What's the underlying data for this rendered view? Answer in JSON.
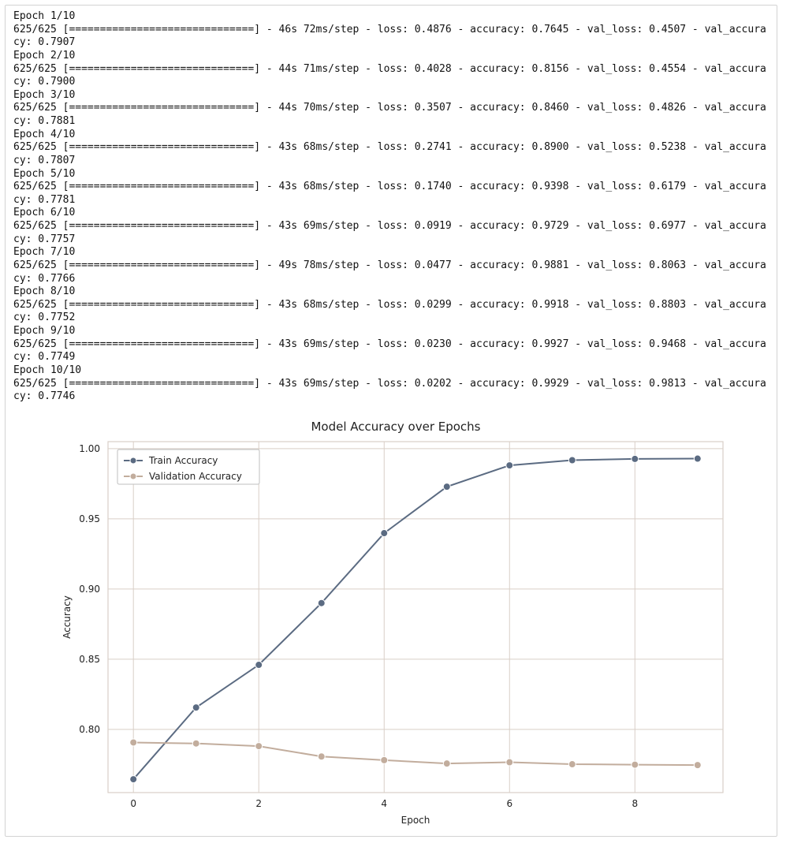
{
  "log": {
    "epochs": [
      {
        "header": "Epoch 1/10",
        "progress": "625/625 [==============================] - 46s 72ms/step - loss: 0.4876 - accuracy: 0.7645 - val_loss: 0.4507 - val_accuracy: 0.7907"
      },
      {
        "header": "Epoch 2/10",
        "progress": "625/625 [==============================] - 44s 71ms/step - loss: 0.4028 - accuracy: 0.8156 - val_loss: 0.4554 - val_accuracy: 0.7900"
      },
      {
        "header": "Epoch 3/10",
        "progress": "625/625 [==============================] - 44s 70ms/step - loss: 0.3507 - accuracy: 0.8460 - val_loss: 0.4826 - val_accuracy: 0.7881"
      },
      {
        "header": "Epoch 4/10",
        "progress": "625/625 [==============================] - 43s 68ms/step - loss: 0.2741 - accuracy: 0.8900 - val_loss: 0.5238 - val_accuracy: 0.7807"
      },
      {
        "header": "Epoch 5/10",
        "progress": "625/625 [==============================] - 43s 68ms/step - loss: 0.1740 - accuracy: 0.9398 - val_loss: 0.6179 - val_accuracy: 0.7781"
      },
      {
        "header": "Epoch 6/10",
        "progress": "625/625 [==============================] - 43s 69ms/step - loss: 0.0919 - accuracy: 0.9729 - val_loss: 0.6977 - val_accuracy: 0.7757"
      },
      {
        "header": "Epoch 7/10",
        "progress": "625/625 [==============================] - 49s 78ms/step - loss: 0.0477 - accuracy: 0.9881 - val_loss: 0.8063 - val_accuracy: 0.7766"
      },
      {
        "header": "Epoch 8/10",
        "progress": "625/625 [==============================] - 43s 68ms/step - loss: 0.0299 - accuracy: 0.9918 - val_loss: 0.8803 - val_accuracy: 0.7752"
      },
      {
        "header": "Epoch 9/10",
        "progress": "625/625 [==============================] - 43s 69ms/step - loss: 0.0230 - accuracy: 0.9927 - val_loss: 0.9468 - val_accuracy: 0.7749"
      },
      {
        "header": "Epoch 10/10",
        "progress": "625/625 [==============================] - 43s 69ms/step - loss: 0.0202 - accuracy: 0.9929 - val_loss: 0.9813 - val_accuracy: 0.7746"
      }
    ]
  },
  "chart_data": {
    "type": "line",
    "title": "Model Accuracy over Epochs",
    "xlabel": "Epoch",
    "ylabel": "Accuracy",
    "x": [
      0,
      1,
      2,
      3,
      4,
      5,
      6,
      7,
      8,
      9
    ],
    "x_ticks": [
      0,
      2,
      4,
      6,
      8
    ],
    "y_ticks": [
      0.8,
      0.85,
      0.9,
      0.95,
      1.0
    ],
    "ylim": [
      0.755,
      1.005
    ],
    "series": [
      {
        "name": "Train Accuracy",
        "values": [
          0.7645,
          0.8156,
          0.846,
          0.89,
          0.9398,
          0.9729,
          0.9881,
          0.9918,
          0.9927,
          0.9929
        ],
        "color": "#5b6b82"
      },
      {
        "name": "Validation Accuracy",
        "values": [
          0.7907,
          0.79,
          0.7881,
          0.7807,
          0.7781,
          0.7757,
          0.7766,
          0.7752,
          0.7749,
          0.7746
        ],
        "color": "#c2ad9d"
      }
    ],
    "legend_position": "upper-left"
  }
}
